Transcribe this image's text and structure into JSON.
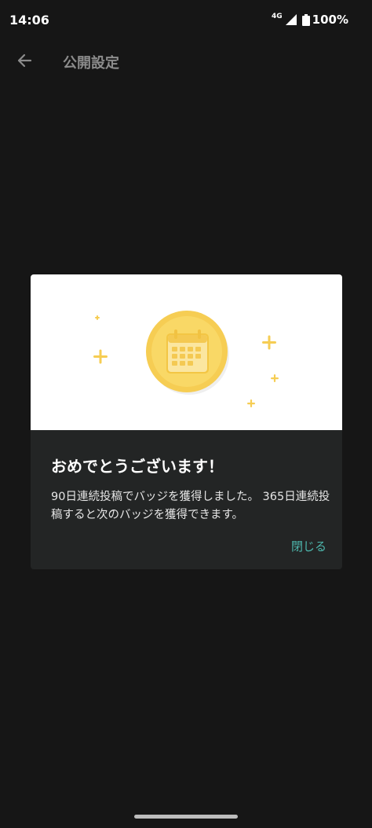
{
  "status_bar": {
    "time": "14:06",
    "network": "4G",
    "battery": "100%"
  },
  "header": {
    "title": "公開設定",
    "back_icon": "arrow-left-icon"
  },
  "dialog": {
    "badge_icon": "calendar-badge-icon",
    "title": "おめでとうございます！",
    "message": "90日連続投稿でバッジを獲得しました。 365日連続投稿すると次のバッジを獲得できます。",
    "close_label": "閉じる",
    "accent_color": "#4db6ac",
    "badge_color": "#f6cd53"
  }
}
